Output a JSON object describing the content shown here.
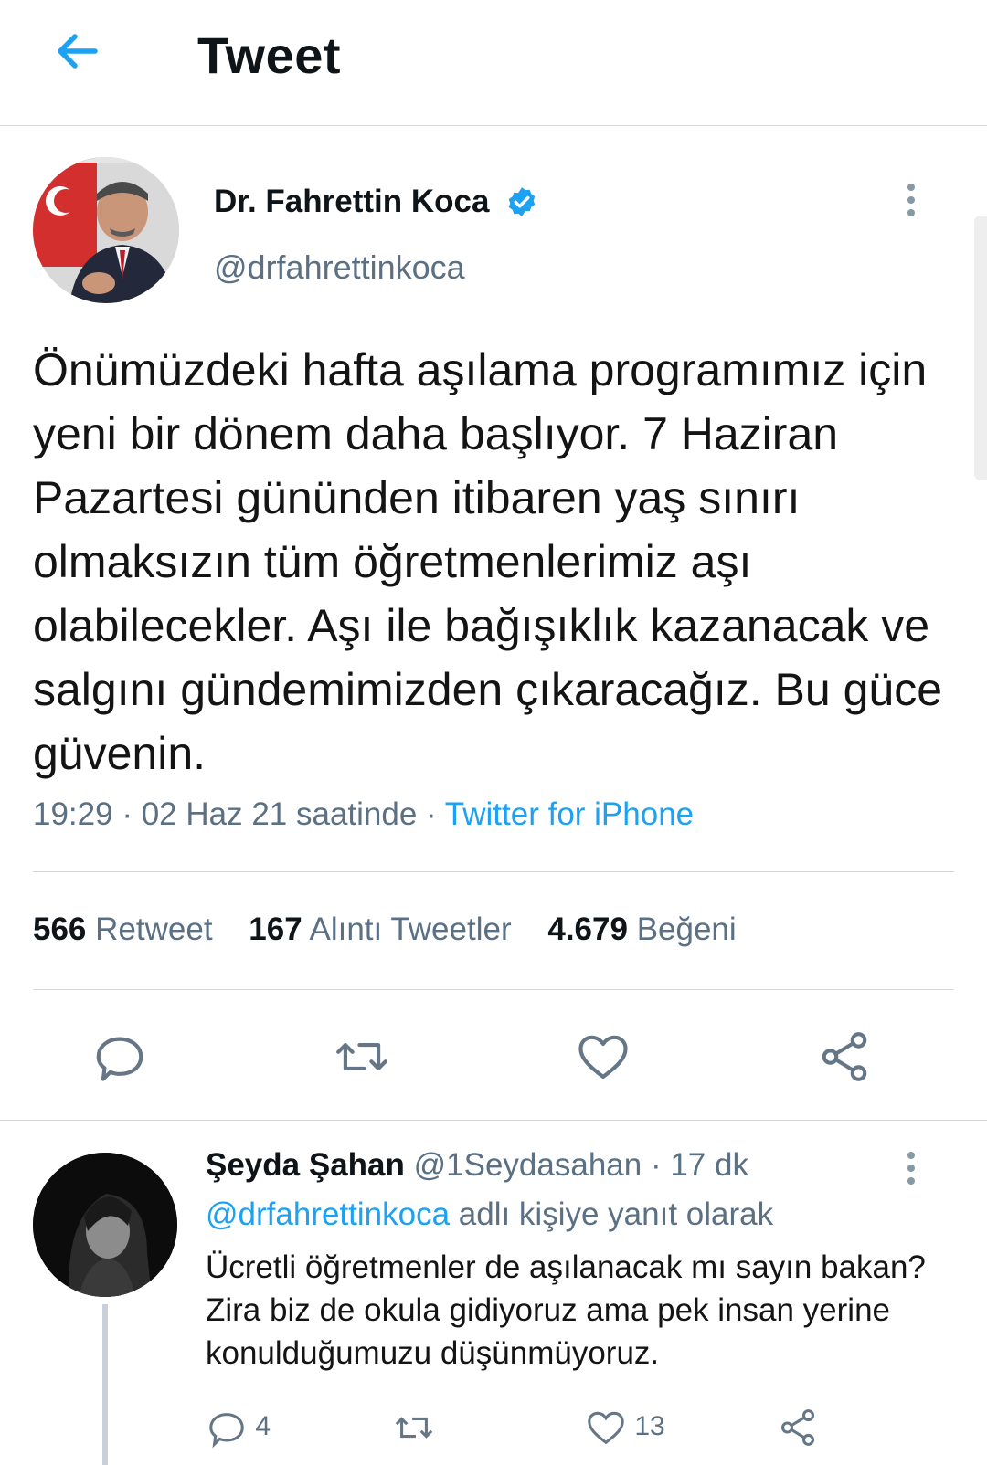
{
  "header": {
    "title": "Tweet"
  },
  "tweet": {
    "author_name": "Dr. Fahrettin Koca",
    "author_handle": "@drfahrettinkoca",
    "text": "Önümüzdeki hafta aşılama programımız için yeni bir dönem daha başlıyor. 7 Haziran Pazartesi gününden itibaren yaş sınırı olmaksızın tüm öğretmenlerimiz aşı olabilecekler. Aşı ile bağışıklık kazanacak ve salgını gündemimizden çıkaracağız. Bu güce güvenin.",
    "time": "19:29",
    "date": "02 Haz 21 saatinde",
    "source": "Twitter for iPhone",
    "retweets": "566",
    "retweets_label": "Retweet",
    "quotes": "167",
    "quotes_label": "Alıntı Tweetler",
    "likes": "4.679",
    "likes_label": "Beğeni"
  },
  "reply": {
    "name": "Şeyda Şahan",
    "handle": "@1Seydasahan",
    "time": "17 dk",
    "replying_to": "@drfahrettinkoca",
    "replying_suffix": "adlı kişiye yanıt olarak",
    "text": "Ücretli öğretmenler de aşılanacak mı sayın bakan? Zira biz de okula gidiyoruz ama pek insan yerine konulduğumuzu düşünmüyoruz.",
    "reply_count": "4",
    "like_count": "13"
  },
  "colors": {
    "accent": "#1da1f2",
    "muted": "#5b7083",
    "divider": "#d8d8d8"
  },
  "icons": [
    "back-arrow-icon",
    "verified-badge-icon",
    "more-icon",
    "reply-icon",
    "retweet-icon",
    "like-icon",
    "share-icon"
  ]
}
